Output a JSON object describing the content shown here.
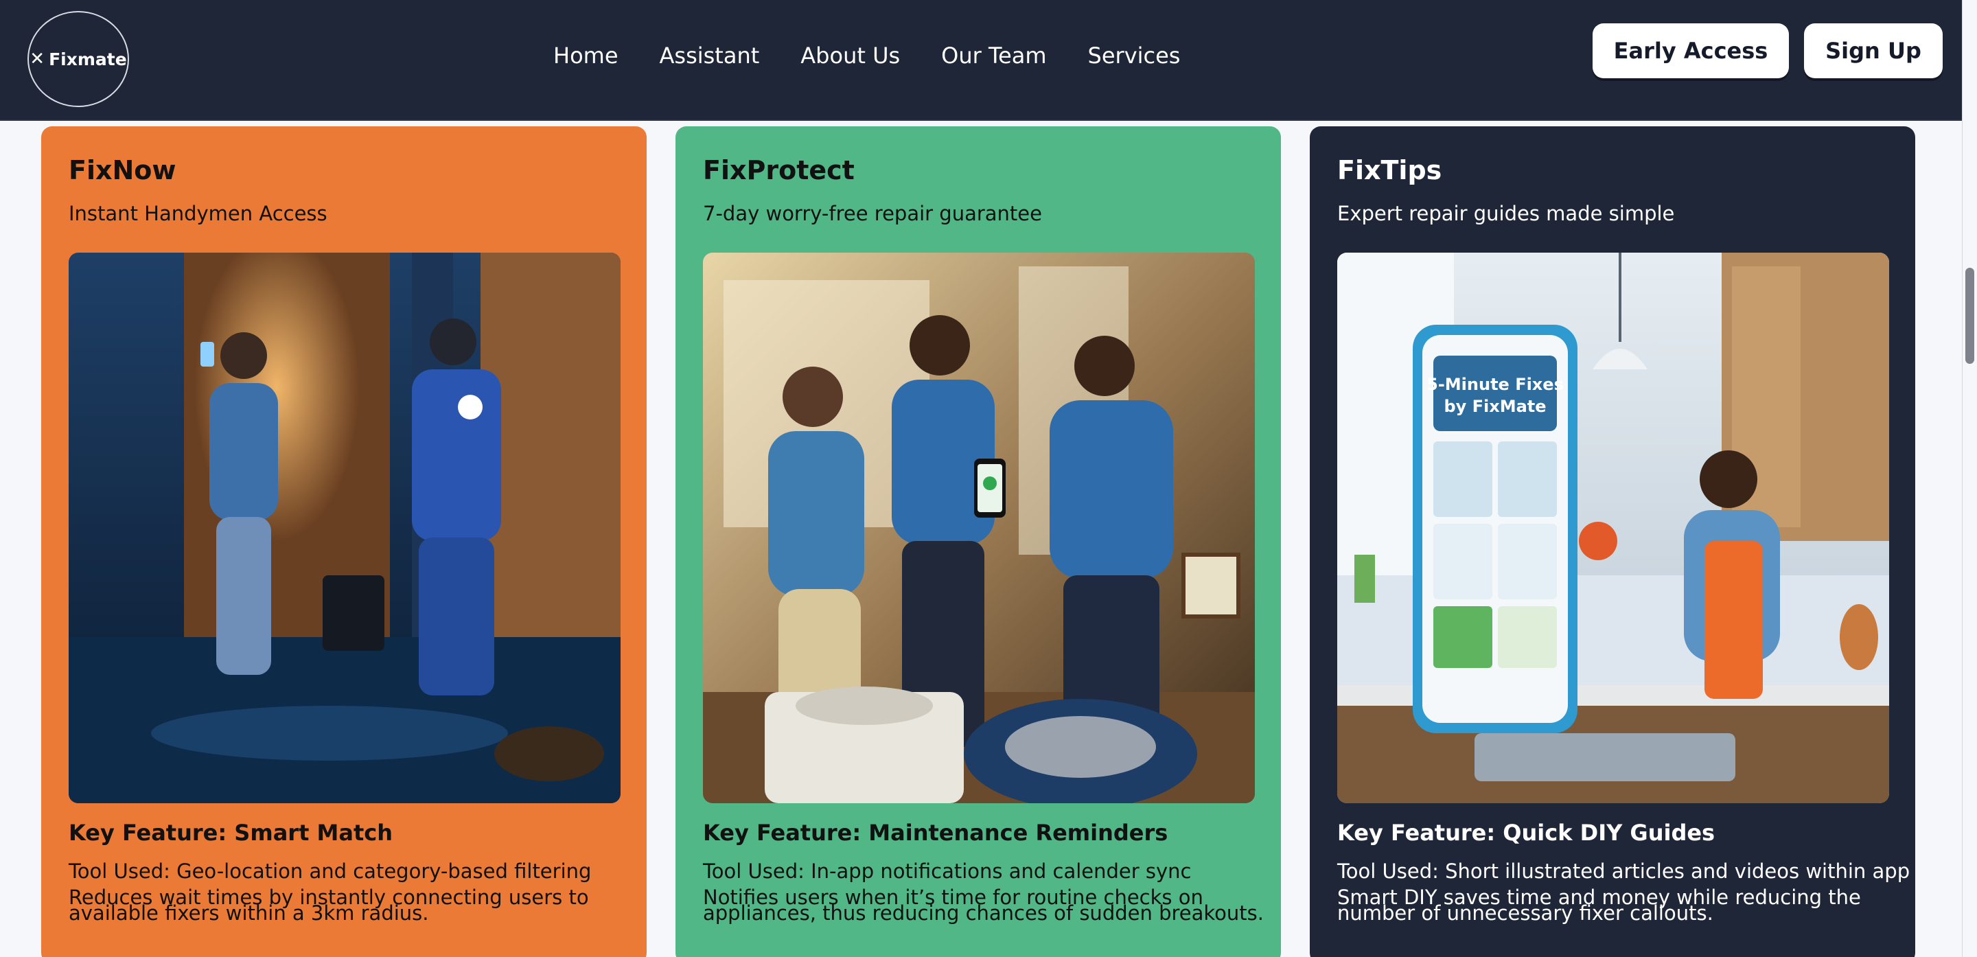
{
  "brand": {
    "name": "Fixmate",
    "icon": "tools-cross-icon"
  },
  "nav": {
    "links": [
      "Home",
      "Assistant",
      "About Us",
      "Our Team",
      "Services"
    ],
    "early_access": "Early Access",
    "sign_up": "Sign Up"
  },
  "cards": [
    {
      "title": "FixNow",
      "subtitle": "Instant Handymen Access",
      "image_alt": "technician-arriving-flooded-home-photo",
      "feature": "Key Feature: Smart Match",
      "tool": "Tool Used: Geo-location and category-based filtering",
      "description": "Reduces wait times by instantly connecting users to available fixers within a 3km radius.",
      "color": "#ea7a36"
    },
    {
      "title": "FixProtect",
      "subtitle": "7-day worry-free repair guarantee",
      "image_alt": "technicians-with-elderly-woman-photo",
      "feature": "Key Feature: Maintenance Reminders",
      "tool": "Tool Used: In-app notifications and calender sync",
      "description": "Notifies users when it’s time for routine checks on appliances, thus reducing chances of sudden breakouts.",
      "color": "#52b786"
    },
    {
      "title": "FixTips",
      "subtitle": "Expert repair guides made simple",
      "image_alt": "diy-guide-phone-kitchen-photo",
      "image_text": "5-Minute Fixes by FixMate",
      "feature": "Key Feature: Quick DIY Guides",
      "tool": "Tool Used: Short illustrated articles and videos within app",
      "description": "Smart DIY saves time and money while reducing the number of unnecessary fixer callouts.",
      "color": "#1f2638"
    }
  ],
  "colors": {
    "navbar": "#1f2638",
    "background": "#f6f7fb",
    "orange": "#ea7a36",
    "green": "#52b786",
    "navy": "#1f2638"
  }
}
